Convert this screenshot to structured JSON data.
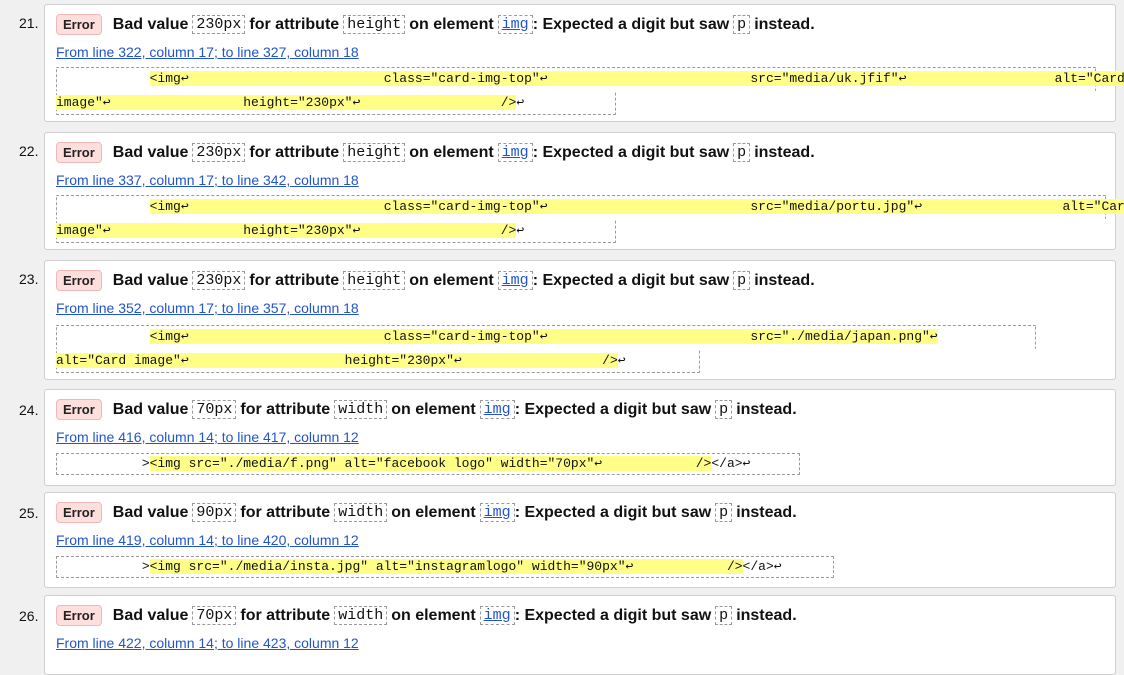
{
  "badge_label": "Error",
  "entries": [
    {
      "num": "21.",
      "msg_pre": "Bad value",
      "value": "230px",
      "msg_attr": "for attribute",
      "attr": "height",
      "msg_elem": "on element",
      "element": "img",
      "msg_expect": ": Expected a digit but saw",
      "saw": "p",
      "msg_end": "instead.",
      "location": "From line 322, column 17; to line 327, column 18",
      "snippet_line1_pre": "            ",
      "snippet_line1_hl": "<img↩                         class=\"card-img-top\"↩                          src=\"media/uk.jfif\"↩                   alt=\"Card",
      "snippet_line2_hl": "image\"↩                 height=\"230px\"↩                  />",
      "snippet_line2_post": "↩"
    },
    {
      "num": "22.",
      "msg_pre": "Bad value",
      "value": "230px",
      "msg_attr": "for attribute",
      "attr": "height",
      "msg_elem": "on element",
      "element": "img",
      "msg_expect": ": Expected a digit but saw",
      "saw": "p",
      "msg_end": "instead.",
      "location": "From line 337, column 17; to line 342, column 18",
      "snippet_line1_pre": "            ",
      "snippet_line1_hl": "<img↩                         class=\"card-img-top\"↩                          src=\"media/portu.jpg\"↩                  alt=\"Card",
      "snippet_line2_hl": "image\"↩                 height=\"230px\"↩                  />",
      "snippet_line2_post": "↩"
    },
    {
      "num": "23.",
      "msg_pre": "Bad value",
      "value": "230px",
      "msg_attr": "for attribute",
      "attr": "height",
      "msg_elem": "on element",
      "element": "img",
      "msg_expect": ": Expected a digit but saw",
      "saw": "p",
      "msg_end": "instead.",
      "location": "From line 352, column 17; to line 357, column 18",
      "snippet_line1_pre": "            ",
      "snippet_line1_hl": "<img↩                         class=\"card-img-top\"↩                          src=\"./media/japan.png\"↩",
      "snippet_line2_hl": "alt=\"Card image\"↩                    height=\"230px\"↩                  />",
      "snippet_line2_post": "↩"
    },
    {
      "num": "24.",
      "msg_pre": "Bad value",
      "value": "70px",
      "msg_attr": "for attribute",
      "attr": "width",
      "msg_elem": "on element",
      "element": "img",
      "msg_expect": ": Expected a digit but saw",
      "saw": "p",
      "msg_end": "instead.",
      "location": "From line 416, column 14; to line 417, column 12",
      "snippet_line1_pre": "           >",
      "snippet_line1_hl": "<img src=\"./media/f.png\" alt=\"facebook logo\" width=\"70px\"↩            />",
      "snippet_line1_post": "</a>↩"
    },
    {
      "num": "25.",
      "msg_pre": "Bad value",
      "value": "90px",
      "msg_attr": "for attribute",
      "attr": "width",
      "msg_elem": "on element",
      "element": "img",
      "msg_expect": ": Expected a digit but saw",
      "saw": "p",
      "msg_end": "instead.",
      "location": "From line 419, column 14; to line 420, column 12",
      "snippet_line1_pre": "           >",
      "snippet_line1_hl": "<img src=\"./media/insta.jpg\" alt=\"instagramlogo\" width=\"90px\"↩            />",
      "snippet_line1_post": "</a>↩"
    },
    {
      "num": "26.",
      "msg_pre": "Bad value",
      "value": "70px",
      "msg_attr": "for attribute",
      "attr": "width",
      "msg_elem": "on element",
      "element": "img",
      "msg_expect": ": Expected a digit but saw",
      "saw": "p",
      "msg_end": "instead.",
      "location": "From line 422, column 14; to line 423, column 12"
    }
  ]
}
